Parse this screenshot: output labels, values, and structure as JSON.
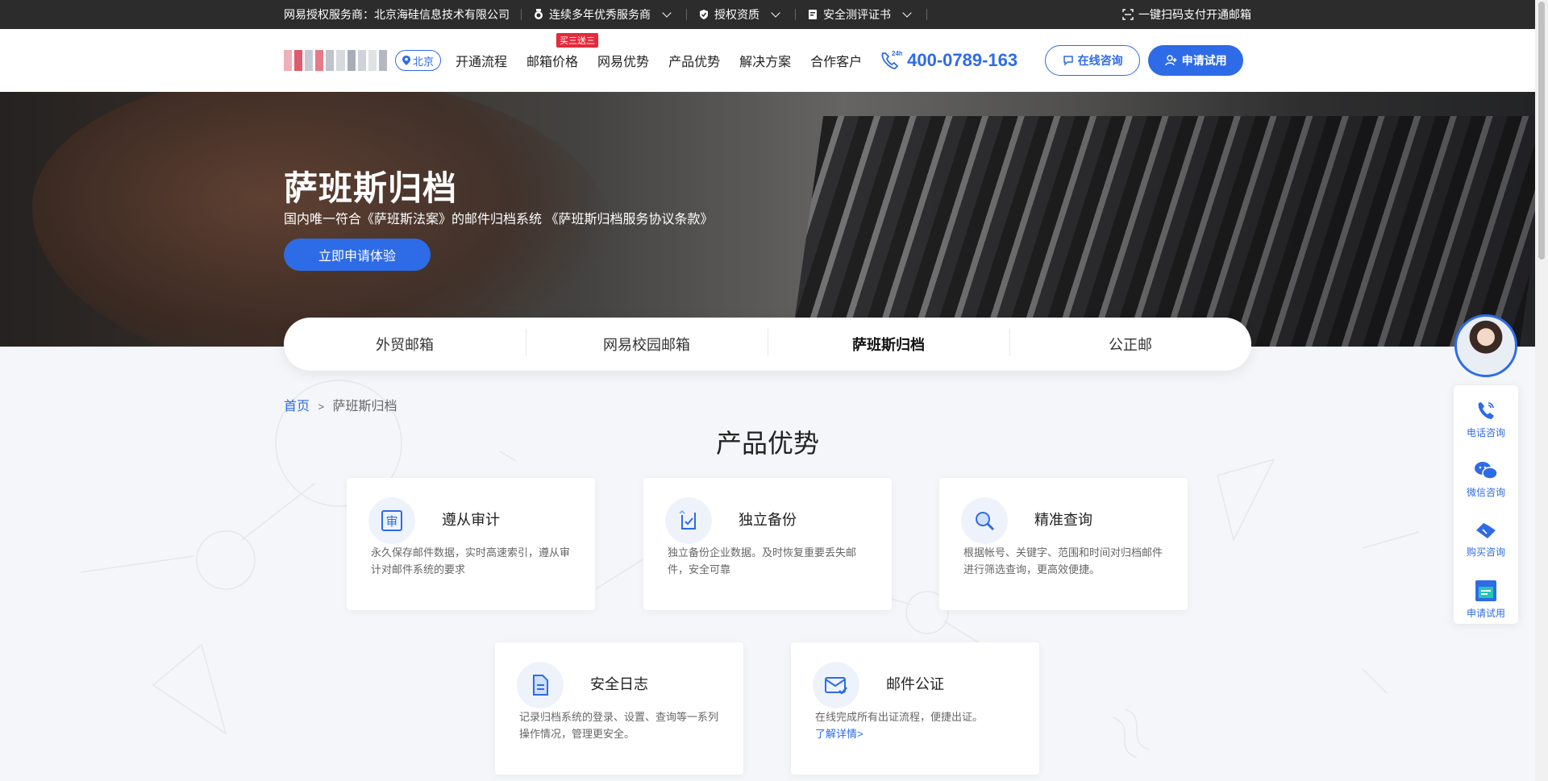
{
  "topbar": {
    "authorized_provider": "网易授权服务商：北京海硅信息技术有限公司",
    "excellent_provider": "连续多年优秀服务商",
    "authorization": "授权资质",
    "security_cert": "安全测评证书",
    "scan_pay": "一键扫码支付开通邮箱"
  },
  "header": {
    "city": "北京",
    "nav": [
      {
        "label": "开通流程"
      },
      {
        "label": "邮箱价格",
        "badge": "买三送三"
      },
      {
        "label": "网易优势"
      },
      {
        "label": "产品优势"
      },
      {
        "label": "解决方案"
      },
      {
        "label": "合作客户"
      }
    ],
    "phone_badge": "24h",
    "phone": "400-0789-163",
    "consult_label": "在线咨询",
    "trial_label": "申请试用"
  },
  "banner": {
    "title": "萨班斯归档",
    "subtitle": "国内唯一符合《萨班斯法案》的邮件归档系统 《萨班斯归档服务协议条款》",
    "cta": "立即申请体验"
  },
  "tabs": [
    {
      "label": "外贸邮箱",
      "active": false
    },
    {
      "label": "网易校园邮箱",
      "active": false
    },
    {
      "label": "萨班斯归档",
      "active": true
    },
    {
      "label": "公正邮",
      "active": false
    }
  ],
  "breadcrumb": {
    "home": "首页",
    "separator": ">",
    "current": "萨班斯归档"
  },
  "section_title": "产品优势",
  "features": [
    {
      "icon": "audit-icon",
      "title": "遵从审计",
      "desc": "永久保存邮件数据，实时高速索引，遵从审计对邮件系统的要求",
      "link": ""
    },
    {
      "icon": "backup-icon",
      "title": "独立备份",
      "desc": "独立备份企业数据。及时恢复重要丢失邮件，安全可靠",
      "link": ""
    },
    {
      "icon": "search-icon",
      "title": "精准查询",
      "desc": "根据帐号、关键字、范围和时间对归档邮件 进行筛选查询，更高效便捷。",
      "link": ""
    },
    {
      "icon": "log-icon",
      "title": "安全日志",
      "desc": "记录归档系统的登录、设置、查询等一系列操作情况，管理更安全。",
      "link": ""
    },
    {
      "icon": "mail-check-icon",
      "title": "邮件公证",
      "desc": "在线完成所有出证流程，便捷出证。",
      "link": "了解详情>"
    }
  ],
  "side_panel": [
    {
      "label": "电话咨询",
      "icon": "phone-icon"
    },
    {
      "label": "微信咨询",
      "icon": "wechat-icon"
    },
    {
      "label": "购买咨询",
      "icon": "handshake-icon"
    },
    {
      "label": "申请试用",
      "icon": "trial-icon"
    }
  ],
  "colors": {
    "brand": "#2e6be6",
    "promo": "#e8283c",
    "topbar": "#2c2c2c"
  }
}
